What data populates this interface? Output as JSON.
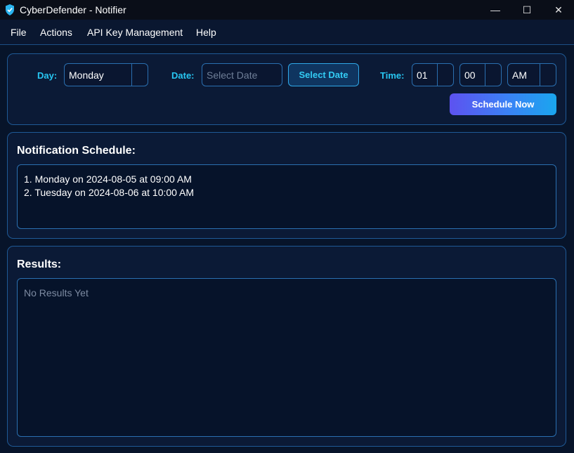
{
  "window": {
    "title": "CyberDefender - Notifier",
    "minimize_glyph": "—",
    "maximize_glyph": "☐",
    "close_glyph": "✕"
  },
  "menu": {
    "items": [
      "File",
      "Actions",
      "API Key Management",
      "Help"
    ]
  },
  "scheduler": {
    "day_label": "Day:",
    "day_value": "Monday",
    "date_label": "Date:",
    "date_placeholder": "Select Date",
    "select_date_button": "Select Date",
    "time_label": "Time:",
    "hour_value": "01",
    "minute_value": "00",
    "ampm_value": "AM",
    "schedule_button": "Schedule Now"
  },
  "schedule": {
    "title": "Notification Schedule:",
    "entries": [
      "1. Monday on 2024-08-05 at 09:00 AM",
      "2. Tuesday on 2024-08-06 at 10:00 AM"
    ]
  },
  "results": {
    "title": "Results:",
    "placeholder": "No Results Yet"
  },
  "colors": {
    "accent_cyan": "#27c6f2",
    "border_blue": "#2a6fb0",
    "gradient_start": "#5d52f0",
    "gradient_end": "#1aa6ee"
  },
  "icons": {
    "app": "shield-icon"
  }
}
